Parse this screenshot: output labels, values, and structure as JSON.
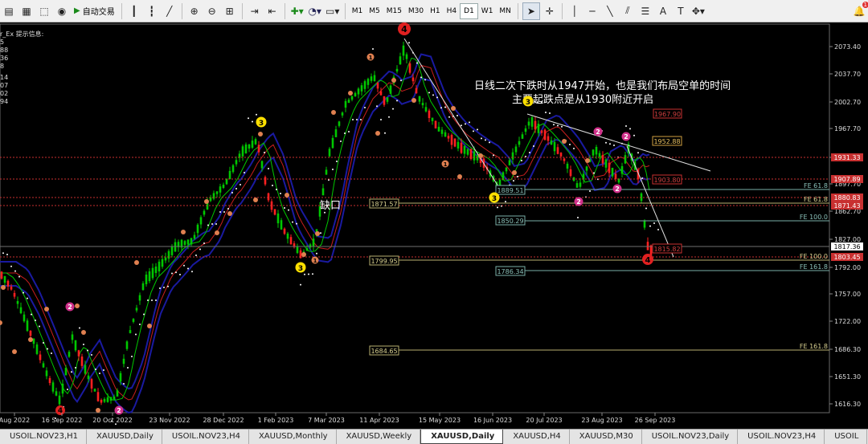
{
  "toolbar": {
    "autotrade_label": "自动交易",
    "timeframes": [
      "M1",
      "M5",
      "M15",
      "M30",
      "H1",
      "H4",
      "D1",
      "W1",
      "MN"
    ],
    "active_timeframe": "D1",
    "notification_count": "1"
  },
  "info_panel": {
    "title": "r_Ex 提示信息:",
    "values": [
      "5",
      "88",
      "36",
      "8",
      "14",
      "07",
      "02",
      "94"
    ]
  },
  "annotations": {
    "line1": "日线二次下跌时从1947开始，也是我们布局空单的时间",
    "line2": "主要起跌点是从1930附近开启",
    "gap_label": "缺口"
  },
  "price_axis": {
    "ticks": [
      "2073.40",
      "2037.70",
      "2002.70",
      "1967.70",
      "1932.70",
      "1897.70",
      "1862.70",
      "1827.00",
      "1792.00",
      "1757.00",
      "1722.00",
      "1686.30",
      "1651.30",
      "1616.30"
    ],
    "current_price": "1817.36",
    "flag_1931": "1931.33",
    "flag_1907": "1907.89",
    "flag_1880": "1880.83",
    "flag_1871": "1871.43",
    "flag_1803": "1803.45"
  },
  "time_axis": [
    "Aug 2022",
    "16 Sep 2022",
    "20 Oct 2022",
    "23 Nov 2022",
    "28 Dec 2022",
    "1 Feb 2023",
    "7 Mar 2023",
    "11 Apr 2023",
    "15 May 2023",
    "16 Jun 2023",
    "20 Jul 2023",
    "23 Aug 2023",
    "26 Sep 2023"
  ],
  "level_boxes": {
    "l1967": "1967.90",
    "l1952": "1952.88",
    "l1903": "1903.80",
    "l1889": "1889.51",
    "l1871": "1871.57",
    "l1850": "1850.29",
    "l1815": "1815.82",
    "l1799": "1799.95",
    "l1786": "1786.34",
    "l1684": "1684.65"
  },
  "fib_labels": {
    "fe618a": "FE 61.8",
    "fe618b": "FE 61.8",
    "fe100a": "FE 100.0",
    "fe100b": "FE 100.0",
    "fe1618a": "FE 161.8",
    "fe1618b": "FE 161.8"
  },
  "wave_labels": {
    "w4_top": "4",
    "w3_left": "3",
    "w3_bottom": "3",
    "w3_mid": "3",
    "w3_jun": "3",
    "w4_bottom": "4",
    "w2_a": "2",
    "w2_b": "2",
    "w2_c": "2",
    "w2_d": "2",
    "w2_left": "2",
    "w2_bl": "2",
    "w4_bl": "4",
    "w1_apr": "1",
    "w1_may": "1",
    "w1_mar": "1"
  },
  "tabs": [
    "USOIL.NOV23,H1",
    "XAUUSD,Daily",
    "USOIL.NOV23,H4",
    "XAUUSD,Monthly",
    "XAUUSD,Weekly",
    "XAUUSD,Daily",
    "XAUUSD,H4",
    "XAUUSD,M30",
    "USOIL.NOV23,Daily",
    "USOIL.NOV23,H4",
    "USOIL"
  ],
  "active_tab": 5,
  "colors": {
    "background": "#000000",
    "bull_candle": "#00c800",
    "bear_candle": "#ff2020",
    "ma_fast": "#00c800",
    "ma_slow": "#c81e1e",
    "envelope": "#1a1aa0",
    "wave_yellow": "#ffe000",
    "wave_red": "#e02020",
    "wave_pink": "#d0308a"
  }
}
